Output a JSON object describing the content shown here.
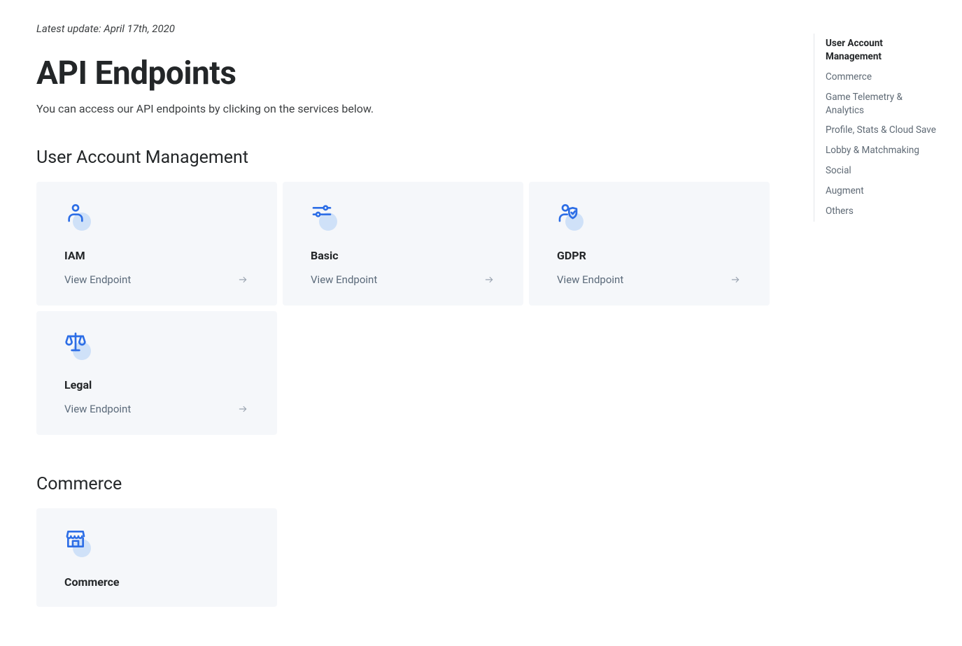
{
  "update_line": "Latest update: April 17th, 2020",
  "page_title": "API Endpoints",
  "page_subtitle": "You can access our API endpoints by clicking on the services below.",
  "view_endpoint_label": "View Endpoint",
  "sections": {
    "user_account": {
      "title": "User Account Management",
      "cards": {
        "iam": "IAM",
        "basic": "Basic",
        "gdpr": "GDPR",
        "legal": "Legal"
      }
    },
    "commerce": {
      "title": "Commerce",
      "cards": {
        "commerce": "Commerce"
      }
    }
  },
  "toc": [
    "User Account Management",
    "Commerce",
    "Game Telemetry & Analytics",
    "Profile, Stats & Cloud Save",
    "Lobby & Matchmaking",
    "Social",
    "Augment",
    "Others"
  ]
}
